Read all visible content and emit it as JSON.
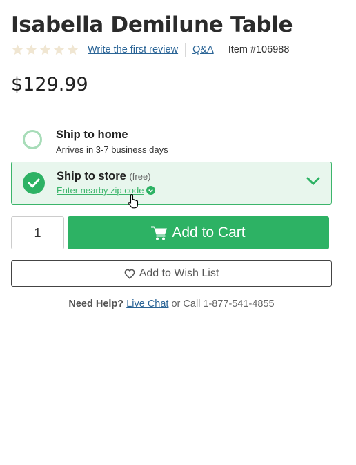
{
  "product": {
    "title": "Isabella Demilune Table",
    "rating_stars": 0,
    "review_link": "Write the first review",
    "qa_link": "Q&A",
    "item_number": "Item #106988",
    "price": "$129.99"
  },
  "shipping": {
    "home": {
      "title": "Ship to home",
      "subtitle": "Arrives in 3-7 business days",
      "selected": false
    },
    "store": {
      "title": "Ship to store",
      "badge": "(free)",
      "zip_link": "Enter nearby zip code",
      "selected": true
    }
  },
  "cart": {
    "quantity": "1",
    "add_to_cart_label": "Add to Cart",
    "wish_list_label": "Add to Wish List"
  },
  "help": {
    "prefix": "Need Help?",
    "live_chat": "Live Chat",
    "call_text": "or Call 1-877-541-4855"
  },
  "colors": {
    "accent_green": "#2db264",
    "link_blue": "#2a6496",
    "star_empty": "#f0e6d2"
  },
  "icons": {
    "stars": "star-icon",
    "check": "check-icon",
    "chevron": "chevron-down-icon",
    "cart": "cart-icon",
    "heart": "heart-icon",
    "cursor": "hand-pointer-icon"
  }
}
